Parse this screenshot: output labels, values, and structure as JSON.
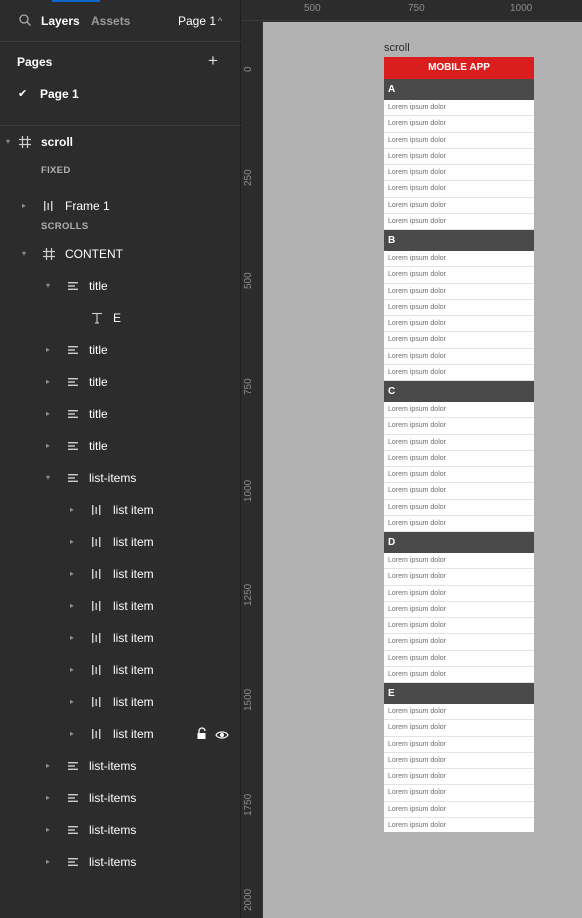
{
  "left_panel": {
    "tabs": {
      "layers": "Layers",
      "assets": "Assets"
    },
    "current_page": "Page 1",
    "pages_title": "Pages",
    "pages": [
      "Page 1"
    ],
    "root_frame": "scroll",
    "section_fixed": "FIXED",
    "section_scrolls": "SCROLLS",
    "fixed_frame": "Frame 1",
    "content_frame": "CONTENT",
    "title_label": "title",
    "text_layer": "E",
    "list_items_label": "list-items",
    "list_item_label": "list item"
  },
  "ruler": {
    "top": [
      "500",
      "750",
      "1000"
    ],
    "left": [
      "0",
      "250",
      "500",
      "750",
      "1000",
      "1250",
      "1500",
      "1750",
      "2000"
    ]
  },
  "canvas": {
    "frame_name": "scroll",
    "app_title": "MOBILE APP",
    "sections": [
      {
        "letter": "A",
        "items": [
          "Lorem ipsum dolor",
          "Lorem ipsum dolor",
          "Lorem ipsum dolor",
          "Lorem ipsum dolor",
          "Lorem ipsum dolor",
          "Lorem ipsum dolor",
          "Lorem ipsum dolor",
          "Lorem ipsum dolor"
        ]
      },
      {
        "letter": "B",
        "items": [
          "Lorem ipsum dolor",
          "Lorem ipsum dolor",
          "Lorem ipsum dolor",
          "Lorem ipsum dolor",
          "Lorem ipsum dolor",
          "Lorem ipsum dolor",
          "Lorem ipsum dolor",
          "Lorem ipsum dolor"
        ]
      },
      {
        "letter": "C",
        "items": [
          "Lorem ipsum dolor",
          "Lorem ipsum dolor",
          "Lorem ipsum dolor",
          "Lorem ipsum dolor",
          "Lorem ipsum dolor",
          "Lorem ipsum dolor",
          "Lorem ipsum dolor",
          "Lorem ipsum dolor"
        ]
      },
      {
        "letter": "D",
        "items": [
          "Lorem ipsum dolor",
          "Lorem ipsum dolor",
          "Lorem ipsum dolor",
          "Lorem ipsum dolor",
          "Lorem ipsum dolor",
          "Lorem ipsum dolor",
          "Lorem ipsum dolor",
          "Lorem ipsum dolor"
        ]
      },
      {
        "letter": "E",
        "items": [
          "Lorem ipsum dolor",
          "Lorem ipsum dolor",
          "Lorem ipsum dolor",
          "Lorem ipsum dolor",
          "Lorem ipsum dolor",
          "Lorem ipsum dolor",
          "Lorem ipsum dolor",
          "Lorem ipsum dolor"
        ]
      }
    ]
  },
  "colors": {
    "accent": "#0d66d0",
    "app_header": "#da1e1e",
    "section_header": "#4a4a4a",
    "canvas_bg": "#b2b2b2",
    "panel_bg": "#2c2c2c"
  },
  "icons": [
    "search-icon",
    "plus-icon",
    "check-icon",
    "frame-hash-icon",
    "autolayout-icon",
    "text-icon",
    "lock-icon",
    "eye-icon"
  ]
}
